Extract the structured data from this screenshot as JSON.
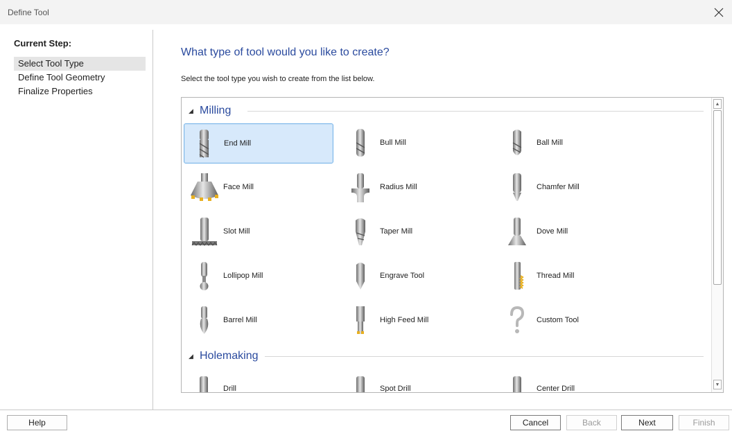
{
  "window": {
    "title": "Define Tool",
    "close_icon": "close-icon"
  },
  "sidebar": {
    "heading": "Current Step:",
    "steps": [
      {
        "label": "Select Tool Type",
        "selected": true
      },
      {
        "label": "Define Tool Geometry",
        "selected": false
      },
      {
        "label": "Finalize Properties",
        "selected": false
      }
    ]
  },
  "main": {
    "title": "What type of tool would you like to create?",
    "subtitle": "Select the tool type you wish to create from the list below."
  },
  "groups": [
    {
      "name": "Milling",
      "tools": [
        {
          "label": "End Mill",
          "icon": "end-mill-icon",
          "selected": true
        },
        {
          "label": "Bull Mill",
          "icon": "bull-mill-icon"
        },
        {
          "label": "Ball Mill",
          "icon": "ball-mill-icon"
        },
        {
          "label": "Face Mill",
          "icon": "face-mill-icon"
        },
        {
          "label": "Radius Mill",
          "icon": "radius-mill-icon"
        },
        {
          "label": "Chamfer Mill",
          "icon": "chamfer-mill-icon"
        },
        {
          "label": "Slot Mill",
          "icon": "slot-mill-icon"
        },
        {
          "label": "Taper Mill",
          "icon": "taper-mill-icon"
        },
        {
          "label": "Dove Mill",
          "icon": "dove-mill-icon"
        },
        {
          "label": "Lollipop Mill",
          "icon": "lollipop-mill-icon"
        },
        {
          "label": "Engrave Tool",
          "icon": "engrave-tool-icon"
        },
        {
          "label": "Thread Mill",
          "icon": "thread-mill-icon"
        },
        {
          "label": "Barrel Mill",
          "icon": "barrel-mill-icon"
        },
        {
          "label": "High Feed Mill",
          "icon": "high-feed-mill-icon"
        },
        {
          "label": "Custom Tool",
          "icon": "custom-tool-icon"
        }
      ]
    },
    {
      "name": "Holemaking",
      "tools": [
        {
          "label": "Drill",
          "icon": "drill-icon"
        },
        {
          "label": "Spot Drill",
          "icon": "spot-drill-icon"
        },
        {
          "label": "Center Drill",
          "icon": "center-drill-icon"
        }
      ]
    }
  ],
  "footer": {
    "help": "Help",
    "cancel": "Cancel",
    "back": "Back",
    "next": "Next",
    "finish": "Finish"
  },
  "colors": {
    "accent": "#2a4a9e",
    "selection_fill": "#d7e9fb",
    "selection_border": "#77b4ea",
    "insert_gold": "#e8b020"
  }
}
